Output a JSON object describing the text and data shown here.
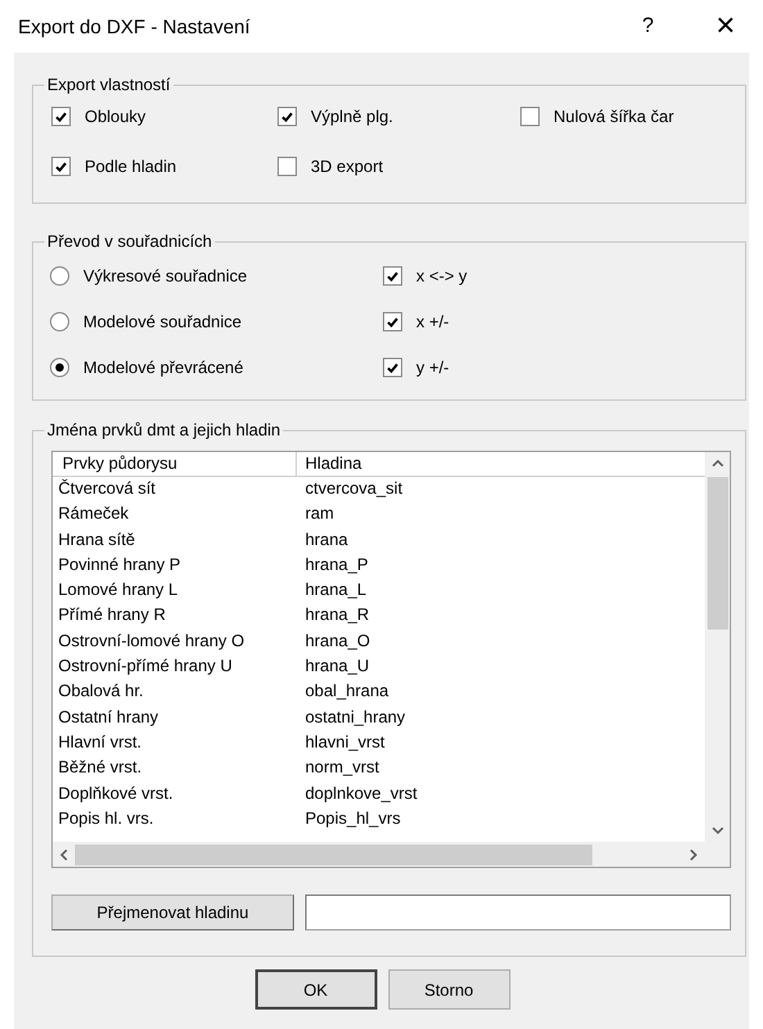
{
  "window": {
    "title": "Export do DXF - Nastavení",
    "help": "?",
    "close": "×"
  },
  "export_group": {
    "title": "Export vlastností",
    "options": [
      {
        "label": "Oblouky",
        "checked": true
      },
      {
        "label": "Výplně plg.",
        "checked": true
      },
      {
        "label": "Nulová šířka čar",
        "checked": false
      },
      {
        "label": "Podle hladin",
        "checked": true
      },
      {
        "label": "3D export",
        "checked": false
      }
    ]
  },
  "coord_group": {
    "title": "Převod v souřadnicích",
    "rows": [
      {
        "radio": {
          "label": "Výkresové souřadnice",
          "selected": false
        },
        "check": {
          "label": "x <-> y",
          "checked": true
        }
      },
      {
        "radio": {
          "label": "Modelové souřadnice",
          "selected": false
        },
        "check": {
          "label": "x +/-",
          "checked": true
        }
      },
      {
        "radio": {
          "label": "Modelové převrácené",
          "selected": true
        },
        "check": {
          "label": "y +/-",
          "checked": true
        }
      }
    ]
  },
  "layers_group": {
    "title": "Jména prvků dmt a jejich hladin",
    "table": {
      "columns": [
        "Prvky půdorysu",
        "Hladina"
      ],
      "rows": [
        [
          "Čtvercová sít",
          "ctvercova_sit"
        ],
        [
          "Rámeček",
          "ram"
        ],
        [
          "Hrana sítě",
          "hrana"
        ],
        [
          "Povinné hrany P",
          "hrana_P"
        ],
        [
          "Lomové hrany L",
          "hrana_L"
        ],
        [
          "Přímé hrany R",
          "hrana_R"
        ],
        [
          "Ostrovní-lomové hrany O",
          "hrana_O"
        ],
        [
          "Ostrovní-přímé hrany U",
          "hrana_U"
        ],
        [
          "Obalová hr.",
          "obal_hrana"
        ],
        [
          "Ostatní hrany",
          "ostatni_hrany"
        ],
        [
          "Hlavní vrst.",
          "hlavni_vrst"
        ],
        [
          "Běžné vrst.",
          "norm_vrst"
        ],
        [
          "Doplňkové vrst.",
          "doplnkove_vrst"
        ],
        [
          "Popis hl. vrs.",
          "Popis_hl_vrs"
        ]
      ]
    },
    "rename_button": "Přejmenovat hladinu"
  },
  "buttons": [
    "OK",
    "Storno"
  ]
}
